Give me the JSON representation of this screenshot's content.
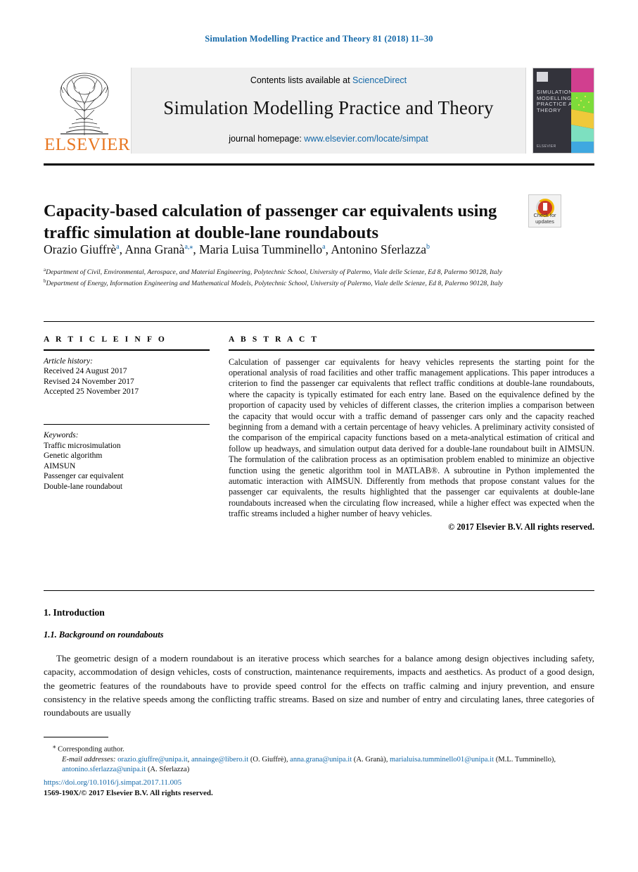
{
  "running_head": "Simulation Modelling Practice and Theory 81 (2018) 11–30",
  "masthead": {
    "contents_prefix": "Contents lists available at ",
    "contents_link": "ScienceDirect",
    "journal_title": "Simulation Modelling Practice and Theory",
    "homepage_prefix": "journal homepage: ",
    "homepage_link": "www.elsevier.com/locate/simpat",
    "publisher": "ELSEVIER",
    "cover_title": "SIMULATION MODELLING PRACTICE AND THEORY",
    "cover_publisher": "ELSEVIER"
  },
  "article": {
    "title": "Capacity-based calculation of passenger car equivalents using traffic simulation at double-lane roundabouts",
    "crossmark_line1": "Check for",
    "crossmark_line2": "updates",
    "authors": [
      {
        "name": "Orazio Giuffrè",
        "sup": "a",
        "star": false
      },
      {
        "name": "Anna Granà",
        "sup": "a",
        "star": true
      },
      {
        "name": "Maria Luisa Tumminello",
        "sup": "a",
        "star": false
      },
      {
        "name": "Antonino Sferlazza",
        "sup": "b",
        "star": false
      }
    ],
    "affiliations": [
      {
        "sup": "a",
        "text": "Department of Civil, Environmental, Aerospace, and Material Engineering, Polytechnic School, University of Palermo, Viale delle Scienze, Ed 8, Palermo 90128, Italy"
      },
      {
        "sup": "b",
        "text": "Department of Energy, Information Engineering and Mathematical Models, Polytechnic School, University of Palermo, Viale delle Scienze, Ed 8, Palermo 90128, Italy"
      }
    ]
  },
  "article_info": {
    "label": "A R T I C L E   I N F O",
    "history_label": "Article history:",
    "history": [
      "Received 24 August 2017",
      "Revised 24 November 2017",
      "Accepted 25 November 2017"
    ],
    "keywords_label": "Keywords:",
    "keywords": [
      "Traffic microsimulation",
      "Genetic algorithm",
      "AIMSUN",
      "Passenger car equivalent",
      "Double-lane roundabout"
    ]
  },
  "abstract": {
    "label": "A B S T R A C T",
    "text": "Calculation of passenger car equivalents for heavy vehicles represents the starting point for the operational analysis of road facilities and other traffic management applications. This paper introduces a criterion to find the passenger car equivalents that reflect traffic conditions at double-lane roundabouts, where the capacity is typically estimated for each entry lane. Based on the equivalence defined by the proportion of capacity used by vehicles of different classes, the criterion implies a comparison between the capacity that would occur with a traffic demand of passenger cars only and the capacity reached beginning from a demand with a certain percentage of heavy vehicles. A preliminary activity consisted of the comparison of the empirical capacity functions based on a meta-analytical estimation of critical and follow up headways, and simulation output data derived for a double-lane roundabout built in AIMSUN. The formulation of the calibration process as an optimisation problem enabled to minimize an objective function using the genetic algorithm tool in MATLAB®. A subroutine in Python implemented the automatic interaction with AIMSUN. Differently from methods that propose constant values for the passenger car equivalents, the results highlighted that the passenger car equivalents at double-lane roundabouts increased when the circulating flow increased, while a higher effect was expected when the traffic streams included a higher number of heavy vehicles.",
    "copyright": "© 2017 Elsevier B.V. All rights reserved."
  },
  "body": {
    "section_number_title": "1. Introduction",
    "subsection_number_title": "1.1. Background on roundabouts",
    "paragraph": "The geometric design of a modern roundabout is an iterative process which searches for a balance among design objectives including safety, capacity, accommodation of design vehicles, costs of construction, maintenance requirements, impacts and aesthetics. As product of a good design, the geometric features of the roundabouts have to provide speed control for the effects on traffic calming and injury prevention, and ensure consistency in the relative speeds among the conflicting traffic streams. Based on size and number of entry and circulating lanes, three categories of roundabouts are usually"
  },
  "footnotes": {
    "corresponding": "Corresponding author.",
    "email_label": "E-mail addresses:",
    "emails": [
      {
        "address": "orazio.giuffre@unipa.it",
        "owner": ""
      },
      {
        "address": "annainge@libero.it",
        "owner": "(O. Giuffrè)"
      },
      {
        "address": "anna.grana@unipa.it",
        "owner": "(A. Granà)"
      },
      {
        "address": "marialuisa.tumminello01@unipa.it",
        "owner": "(M.L. Tumminello)"
      },
      {
        "address": "antonino.sferlazza@unipa.it",
        "owner": "(A. Sferlazza)"
      }
    ],
    "doi": "https://doi.org/10.1016/j.simpat.2017.11.005",
    "issn_line": "1569-190X/© 2017 Elsevier B.V. All rights reserved."
  },
  "colors": {
    "link": "#1368a8",
    "elsevier_orange": "#E87722",
    "masthead_bg": "#efefef"
  }
}
